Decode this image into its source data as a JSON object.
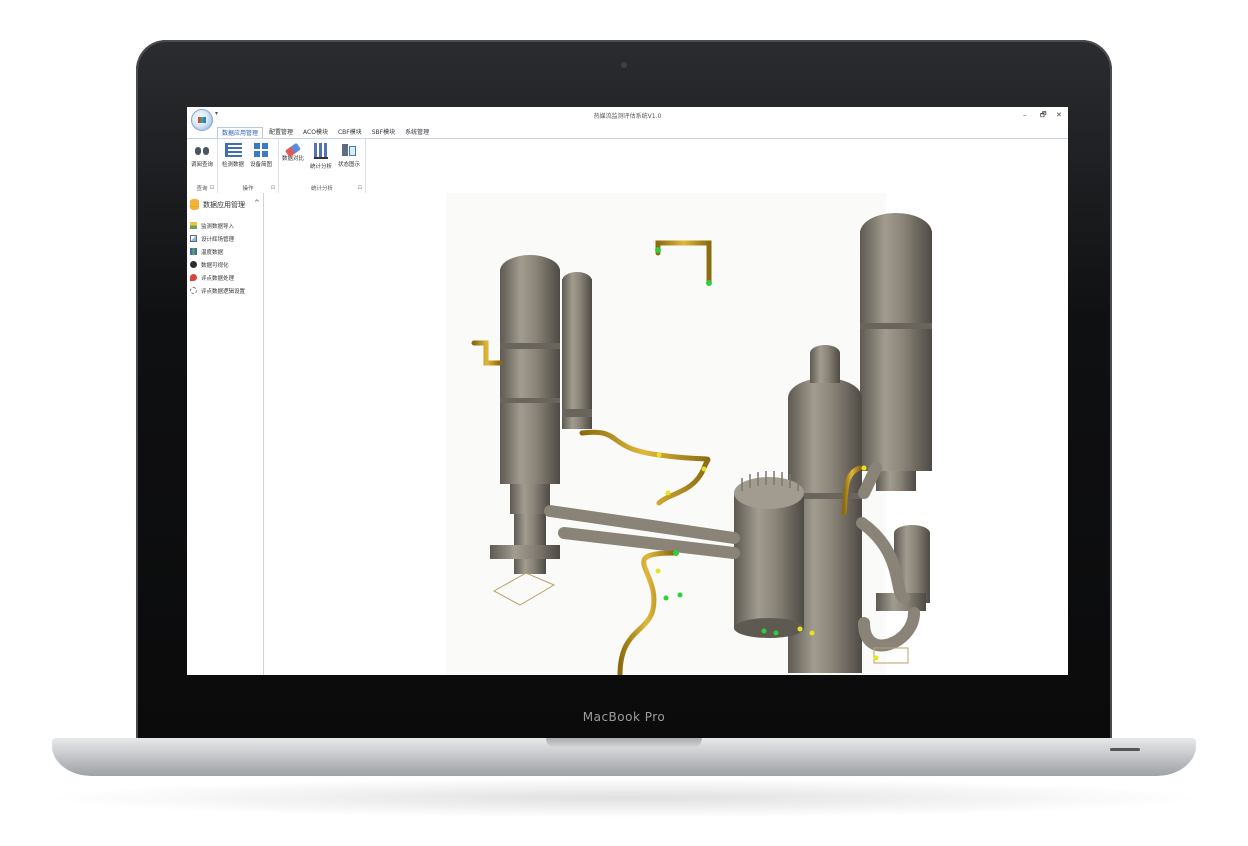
{
  "device": {
    "brand_label": "MacBook Pro"
  },
  "window": {
    "title": "热媒流监测评估系统V1.0",
    "quick_access": "▾",
    "controls": {
      "minimize": "–",
      "restore": "🗗",
      "close": "✕"
    }
  },
  "menu": {
    "tabs": [
      {
        "label": "数据应用管理",
        "active": true
      },
      {
        "label": "配置管理"
      },
      {
        "label": "ACO模块"
      },
      {
        "label": "CBF模块"
      },
      {
        "label": "SBF模块"
      },
      {
        "label": "系统管理"
      }
    ]
  },
  "ribbon": {
    "groups": [
      {
        "label": "查询",
        "buttons": [
          {
            "label": "调阅查询",
            "icon": "binoculars-icon"
          }
        ]
      },
      {
        "label": "操作",
        "buttons": [
          {
            "label": "检测数据",
            "icon": "list-icon"
          },
          {
            "label": "设备简图",
            "icon": "grid-icon"
          }
        ]
      },
      {
        "label": "统计分析",
        "buttons": [
          {
            "label": "数据对比",
            "icon": "eraser-icon"
          },
          {
            "label": "统计分析",
            "icon": "bar-chart-icon"
          },
          {
            "label": "状态图示",
            "icon": "flowchart-icon"
          }
        ]
      }
    ],
    "launcher": "⊡"
  },
  "nav": {
    "title": "数据应用管理",
    "collapse": "^",
    "items": [
      {
        "label": "监测数据导入",
        "icon": "import-icon"
      },
      {
        "label": "设计辉场管理",
        "icon": "image-icon"
      },
      {
        "label": "温度数据",
        "icon": "data-icon"
      },
      {
        "label": "数据可视化",
        "icon": "visual-icon"
      },
      {
        "label": "评点数据处理",
        "icon": "process-icon"
      },
      {
        "label": "评点数据逻辑设置",
        "icon": "settings-icon"
      }
    ]
  },
  "colors": {
    "accent": "#2b5fb3",
    "vessel": "#8a8478",
    "pipe": "#c9a227",
    "sensor_green": "#2fcf3a",
    "sensor_yellow": "#e8e21c"
  }
}
